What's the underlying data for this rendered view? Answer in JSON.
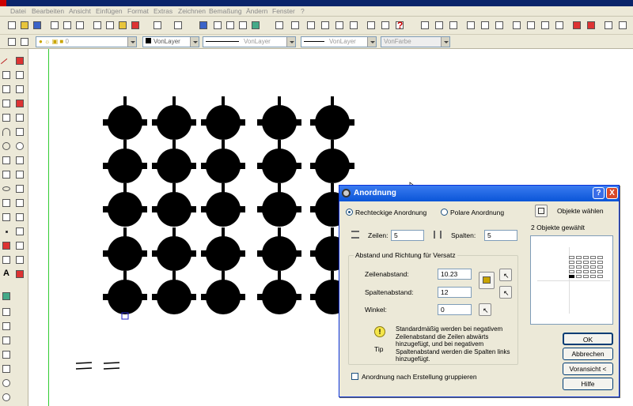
{
  "menu": [
    "Datei",
    "Bearbeiten",
    "Ansicht",
    "Einfügen",
    "Format",
    "Extras",
    "Zeichnen",
    "Bemaßung",
    "Ändern",
    "Fenster",
    "?"
  ],
  "layer_combo": "0",
  "color_combo": "VonLayer",
  "linetype_combo": "VonLayer",
  "lineweight_combo": "VonLayer",
  "plotstyle_combo": "VonFarbe",
  "dialog": {
    "title": "Anordnung",
    "help_btn": "?",
    "close_btn": "X",
    "rect_label": "Rechteckige Anordnung",
    "polar_label": "Polare Anordnung",
    "select_label": "Objekte wählen",
    "selected_count": "2 Objekte gewählt",
    "rows_label": "Zeilen:",
    "rows_value": "5",
    "cols_label": "Spalten:",
    "cols_value": "5",
    "offset_group": "Abstand und Richtung für Versatz",
    "row_offset_label": "Zeilenabstand:",
    "row_offset_value": "10.23",
    "col_offset_label": "Spaltenabstand:",
    "col_offset_value": "12",
    "angle_label": "Winkel:",
    "angle_value": "0",
    "tip_label": "Tip",
    "tip_text": "Standardmäßig werden bei negativem Zeilenabstand die Zeilen abwärts hinzugefügt, und bei negativem Spaltenabstand werden die Spalten links hinzugefügt.",
    "group_label": "Anordnung nach Erstellung gruppieren",
    "ok": "OK",
    "cancel": "Abbrechen",
    "preview_btn": "Voransicht <",
    "help": "Hilfe"
  }
}
